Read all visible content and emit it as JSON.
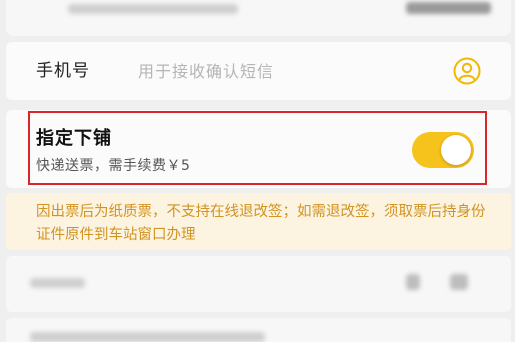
{
  "phone_row": {
    "label": "手机号",
    "placeholder": "用于接收确认短信",
    "value": ""
  },
  "berth_option": {
    "title": "指定下铺",
    "subtitle": "快递送票，需手续费￥5",
    "enabled": true
  },
  "notice": {
    "text": "因出票后为纸质票，不支持在线退改签；如需退改签，须取票后持身份证件原件到车站窗口办理"
  },
  "icons": {
    "contact": "person-circle-icon"
  },
  "colors": {
    "accent": "#f6c21c",
    "notice_text": "#d29322",
    "notice_bg": "#fcf4e0",
    "highlight_frame": "#d8262a"
  }
}
